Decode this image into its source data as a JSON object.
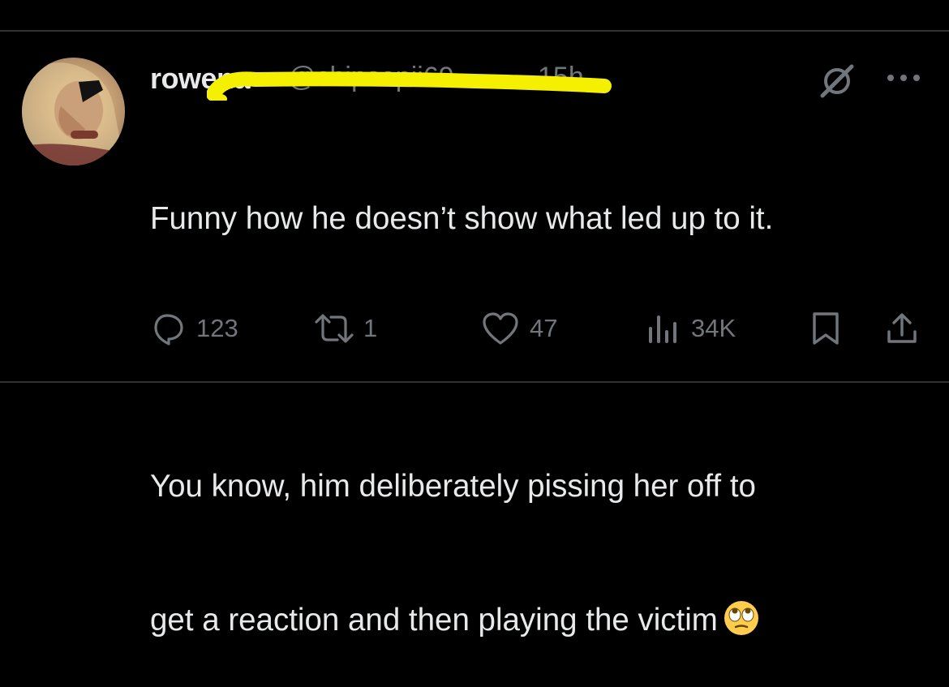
{
  "post": {
    "author_name": "rowena",
    "handle": "@chipsepii69",
    "timestamp": "15h",
    "text_line1": "Funny how he doesn’t show what led up to it.",
    "text_line2": "You know, him deliberately pissing her off to",
    "text_line3": "get a reaction and then playing the victim",
    "emoji": "face-with-rolling-eyes"
  },
  "actions": {
    "replies": "123",
    "reposts": "1",
    "likes": "47",
    "views": "34K"
  },
  "colors": {
    "background": "#000000",
    "text": "#e7e9ea",
    "muted": "#71767b",
    "divider": "#2f3336",
    "redaction_marker": "#f5f000"
  }
}
